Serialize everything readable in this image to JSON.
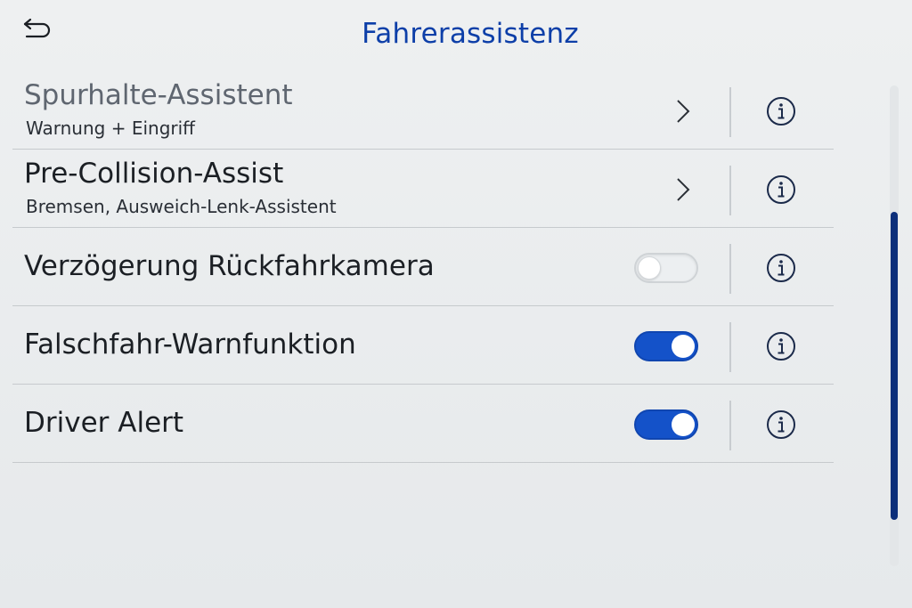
{
  "header": {
    "title": "Fahrerassistenz",
    "back_icon": "back-arrow-icon"
  },
  "rows": [
    {
      "title": "Spurhalte-Assistent",
      "subtitle": "Warnung + Eingriff",
      "control": "chevron"
    },
    {
      "title": "Pre-Collision-Assist",
      "subtitle": "Bremsen, Ausweich-Lenk-Assistent",
      "control": "chevron"
    },
    {
      "title": "Verzögerung Rückfahrkamera",
      "control": "toggle",
      "enabled": false
    },
    {
      "title": "Falschfahr-Warnfunktion",
      "control": "toggle",
      "enabled": true
    },
    {
      "title": "Driver Alert",
      "control": "toggle",
      "enabled": true
    }
  ],
  "colors": {
    "accent": "#1452c9",
    "title": "#0d3fa8",
    "scroll_thumb": "#0c2f7a"
  },
  "scroll": {
    "thumb_fraction": 0.64,
    "position_fraction": 0.26
  }
}
